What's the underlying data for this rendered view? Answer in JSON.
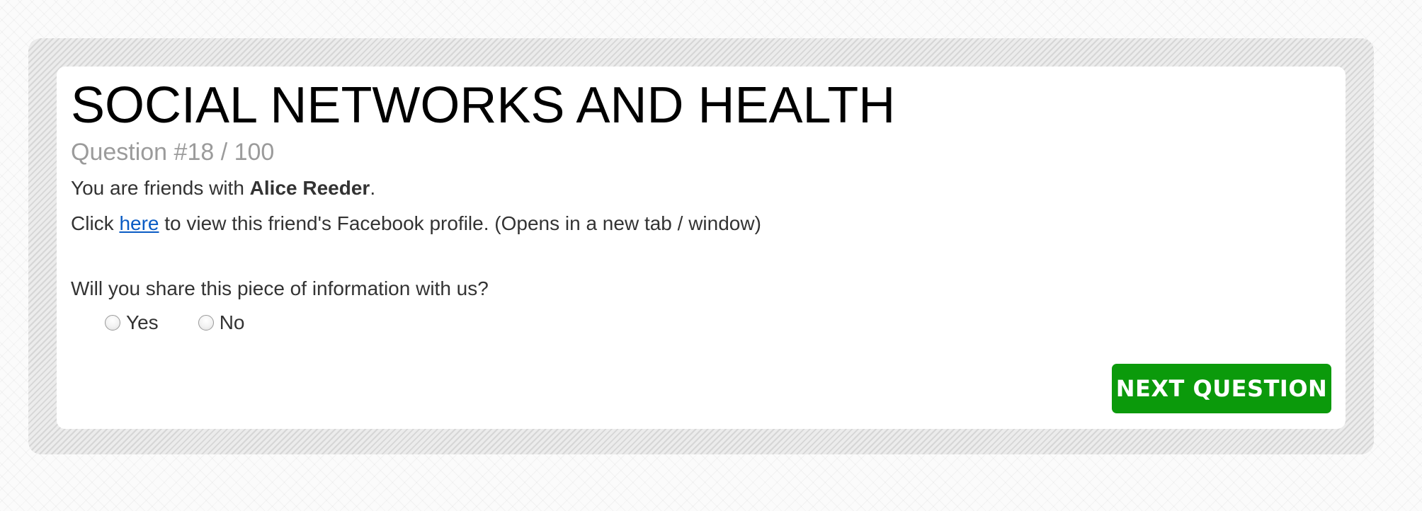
{
  "survey": {
    "title": "SOCIAL NETWORKS AND HEALTH",
    "question_progress": "Question #18 / 100",
    "friend_prefix": "You are friends with ",
    "friend_name": "Alice Reeder",
    "friend_suffix": ".",
    "profile_prefix": "Click ",
    "profile_link": "here",
    "profile_suffix": " to view this friend's Facebook profile. (Opens in a new tab / window)",
    "question": "Will you share this piece of information with us?",
    "options": [
      {
        "label": "Yes",
        "selected": false
      },
      {
        "label": "No",
        "selected": false
      }
    ],
    "next_button": "NEXT QUESTION"
  },
  "colors": {
    "accent_button": "#0b9a0b",
    "link": "#0a5bc4",
    "muted_text": "#9b9b9b"
  }
}
